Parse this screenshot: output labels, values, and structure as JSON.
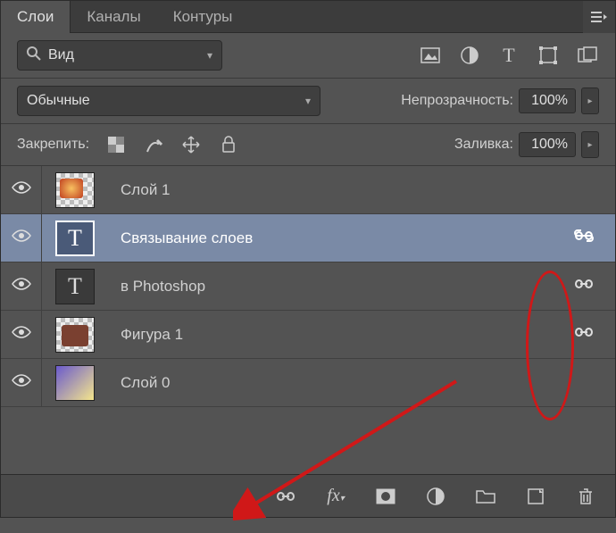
{
  "tabs": {
    "layers": "Слои",
    "channels": "Каналы",
    "paths": "Контуры"
  },
  "filter": {
    "label": "Вид"
  },
  "blend": {
    "mode": "Обычные",
    "opacity_label": "Непрозрачность:",
    "opacity_value": "100%"
  },
  "lock": {
    "label": "Закрепить:",
    "fill_label": "Заливка:",
    "fill_value": "100%"
  },
  "layers": [
    {
      "name": "Слой 1",
      "thumb": "checker-img",
      "linked": false,
      "selected": false
    },
    {
      "name": "Связывание слоев",
      "thumb": "text",
      "linked": true,
      "selected": true
    },
    {
      "name": "в Photoshop",
      "thumb": "text-dark",
      "linked": true,
      "selected": false
    },
    {
      "name": "Фигура 1",
      "thumb": "checker-shape",
      "linked": true,
      "selected": false
    },
    {
      "name": "Слой 0",
      "thumb": "grad",
      "linked": false,
      "selected": false
    }
  ]
}
